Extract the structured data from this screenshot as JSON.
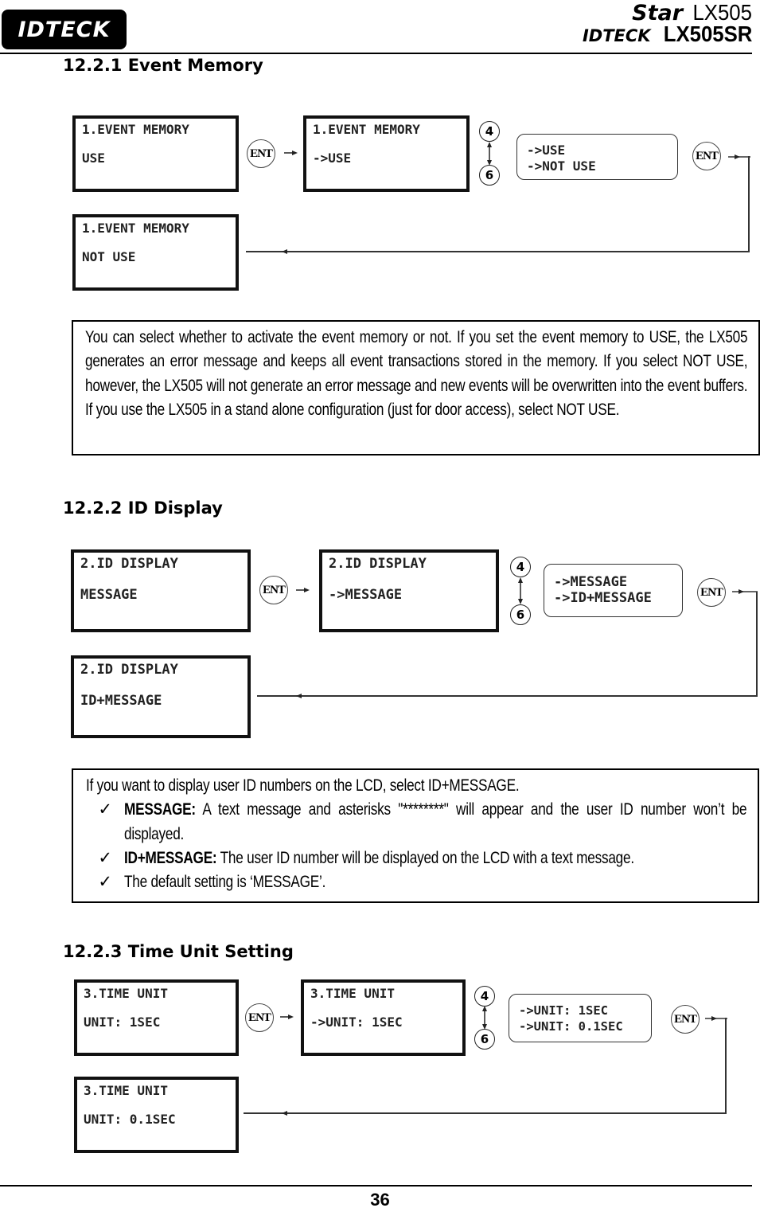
{
  "header": {
    "logo_text": "IDTECK",
    "brand_mark_top": "Star",
    "brand_model_top": "LX505",
    "brand_mark_bottom": "IDTECK",
    "brand_model_bottom": "LX505SR"
  },
  "sections": [
    {
      "title": "12.2.1 Event Memory",
      "diagram": {
        "screen_current": {
          "line1": "1.EVENT MEMORY",
          "line2": "USE"
        },
        "screen_edit": {
          "line1": "1.EVENT MEMORY",
          "line2": "->USE"
        },
        "options": [
          "->USE",
          "->NOT USE"
        ],
        "screen_result": {
          "line1": "1.EVENT MEMORY",
          "line2": "NOT USE"
        },
        "ent_key": "ENT",
        "key_up": "4",
        "key_down": "6"
      },
      "note": "You can select whether to activate the event memory or not. If you set the event memory to USE, the LX505 generates an error message and keeps all event transactions stored in the memory. If you select NOT USE, however, the LX505 will not generate an error message and new events will be overwritten into the event buffers. If you use the LX505 in a stand alone configuration (just for door access), select NOT USE."
    },
    {
      "title": "12.2.2 ID Display",
      "diagram": {
        "screen_current": {
          "line1": "2.ID DISPLAY",
          "line2": "MESSAGE"
        },
        "screen_edit": {
          "line1": "2.ID DISPLAY",
          "line2": "->MESSAGE"
        },
        "options": [
          "->MESSAGE",
          "->ID+MESSAGE"
        ],
        "screen_result": {
          "line1": "2.ID DISPLAY",
          "line2": "ID+MESSAGE"
        },
        "ent_key": "ENT",
        "key_up": "4",
        "key_down": "6"
      },
      "note_intro": "If you want to display user ID numbers on the LCD, select ID+MESSAGE.",
      "note_items": [
        {
          "check": "✓",
          "label": "MESSAGE:",
          "text": " A text message and asterisks \"********\" will appear and the user ID number won’t be displayed."
        },
        {
          "check": "✓",
          "label": "ID+MESSAGE:",
          "text": " The user ID number will be displayed on the LCD with a text message."
        },
        {
          "check": "✓",
          "label": "",
          "text": "The default setting is ‘MESSAGE’."
        }
      ]
    },
    {
      "title": "12.2.3 Time Unit Setting",
      "diagram": {
        "screen_current": {
          "line1": "3.TIME UNIT",
          "line2": "UNIT: 1SEC"
        },
        "screen_edit": {
          "line1": "3.TIME UNIT",
          "line2": "->UNIT: 1SEC"
        },
        "options": [
          "->UNIT: 1SEC",
          "->UNIT: 0.1SEC"
        ],
        "screen_result": {
          "line1": "3.TIME UNIT",
          "line2": "UNIT: 0.1SEC"
        },
        "ent_key": "ENT",
        "key_up": "4",
        "key_down": "6"
      }
    }
  ],
  "footer": {
    "page_number": "36"
  }
}
